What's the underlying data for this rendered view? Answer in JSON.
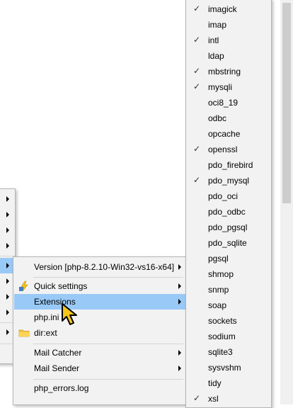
{
  "php_menu": {
    "items": [
      {
        "label": "Version [php-8.2.10-Win32-vs16-x64]",
        "submenu": true
      },
      {
        "label": "Quick settings",
        "submenu": true,
        "icon": "lightning-icon"
      },
      {
        "label": "Extensions",
        "submenu": true,
        "highlighted": true
      },
      {
        "label": "php.ini",
        "submenu": false
      },
      {
        "label": "dir:ext",
        "submenu": false,
        "icon": "folder-icon"
      },
      {
        "label": "Mail Catcher",
        "submenu": true
      },
      {
        "label": "Mail Sender",
        "submenu": true
      },
      {
        "label": "php_errors.log",
        "submenu": false
      }
    ]
  },
  "extensions": [
    {
      "label": "imagick",
      "checked": true
    },
    {
      "label": "imap",
      "checked": false
    },
    {
      "label": "intl",
      "checked": true
    },
    {
      "label": "ldap",
      "checked": false
    },
    {
      "label": "mbstring",
      "checked": true
    },
    {
      "label": "mysqli",
      "checked": true
    },
    {
      "label": "oci8_19",
      "checked": false
    },
    {
      "label": "odbc",
      "checked": false
    },
    {
      "label": "opcache",
      "checked": false
    },
    {
      "label": "openssl",
      "checked": true
    },
    {
      "label": "pdo_firebird",
      "checked": false
    },
    {
      "label": "pdo_mysql",
      "checked": true
    },
    {
      "label": "pdo_oci",
      "checked": false
    },
    {
      "label": "pdo_odbc",
      "checked": false
    },
    {
      "label": "pdo_pgsql",
      "checked": false
    },
    {
      "label": "pdo_sqlite",
      "checked": false
    },
    {
      "label": "pgsql",
      "checked": false
    },
    {
      "label": "shmop",
      "checked": false
    },
    {
      "label": "snmp",
      "checked": false
    },
    {
      "label": "soap",
      "checked": false
    },
    {
      "label": "sockets",
      "checked": false
    },
    {
      "label": "sodium",
      "checked": false
    },
    {
      "label": "sqlite3",
      "checked": false
    },
    {
      "label": "sysvshm",
      "checked": false
    },
    {
      "label": "tidy",
      "checked": false
    },
    {
      "label": "xsl",
      "checked": true
    }
  ],
  "check_glyph": "✓",
  "colors": {
    "highlight": "#99c9f7",
    "menu_bg": "#f2f2f2"
  }
}
